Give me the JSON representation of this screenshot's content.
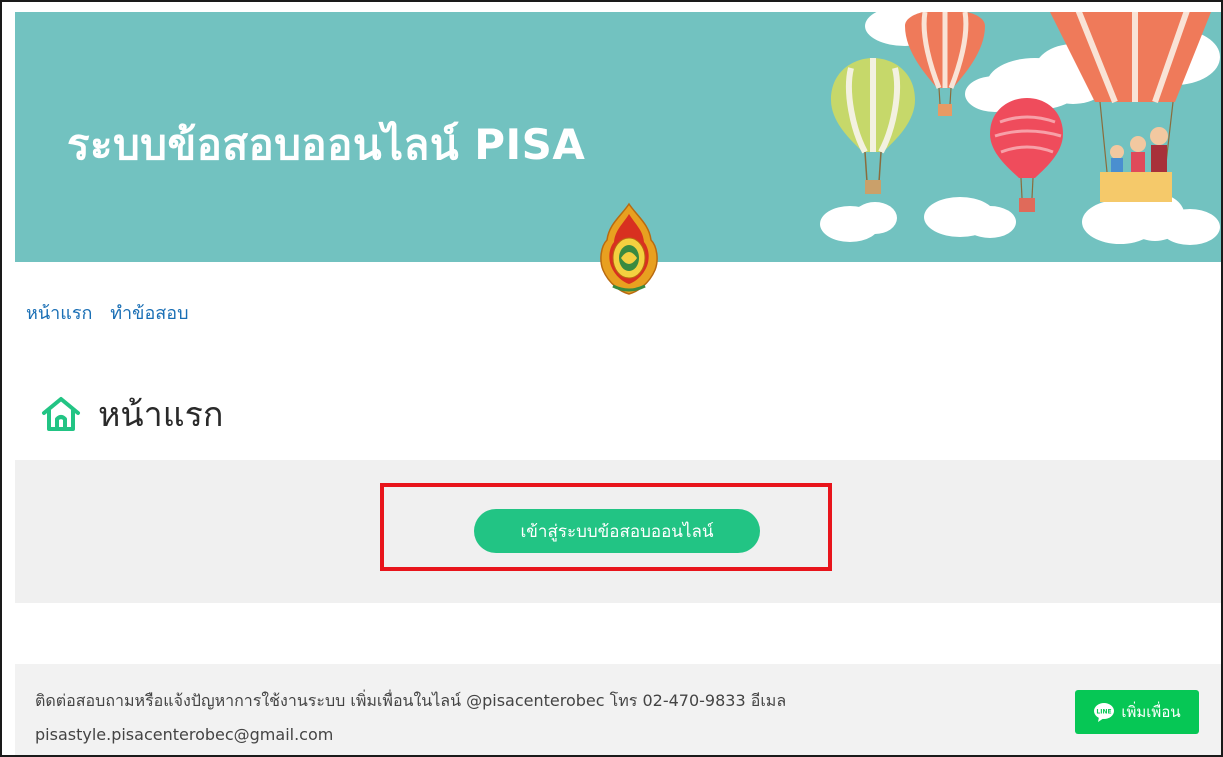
{
  "banner": {
    "title": "ระบบข้อสอบออนไลน์ PISA"
  },
  "nav": {
    "items": [
      {
        "label": "หน้าแรก"
      },
      {
        "label": "ทำข้อสอบ"
      }
    ]
  },
  "page": {
    "heading": "หน้าแรก"
  },
  "main": {
    "enter_button": "เข้าสู่ระบบข้อสอบออนไลน์"
  },
  "footer": {
    "line1": "ติดต่อสอบถามหรือแจ้งปัญหาการใช้งานระบบ เพิ่มเพื่อนในไลน์ @pisacenterobec โทร 02-470-9833 อีเมล",
    "line2": "pisastyle.pisacenterobec@gmail.com",
    "line_button": "เพิ่มเพื่อน",
    "line_badge": "LINE"
  },
  "colors": {
    "banner": "#72c2c0",
    "accent": "#22c484",
    "highlight": "#e8141b",
    "line_green": "#06c755",
    "link": "#1a6fb5"
  },
  "icons": [
    "home-icon",
    "line-logo-icon",
    "hot-air-balloon-icon",
    "emblem-icon"
  ]
}
